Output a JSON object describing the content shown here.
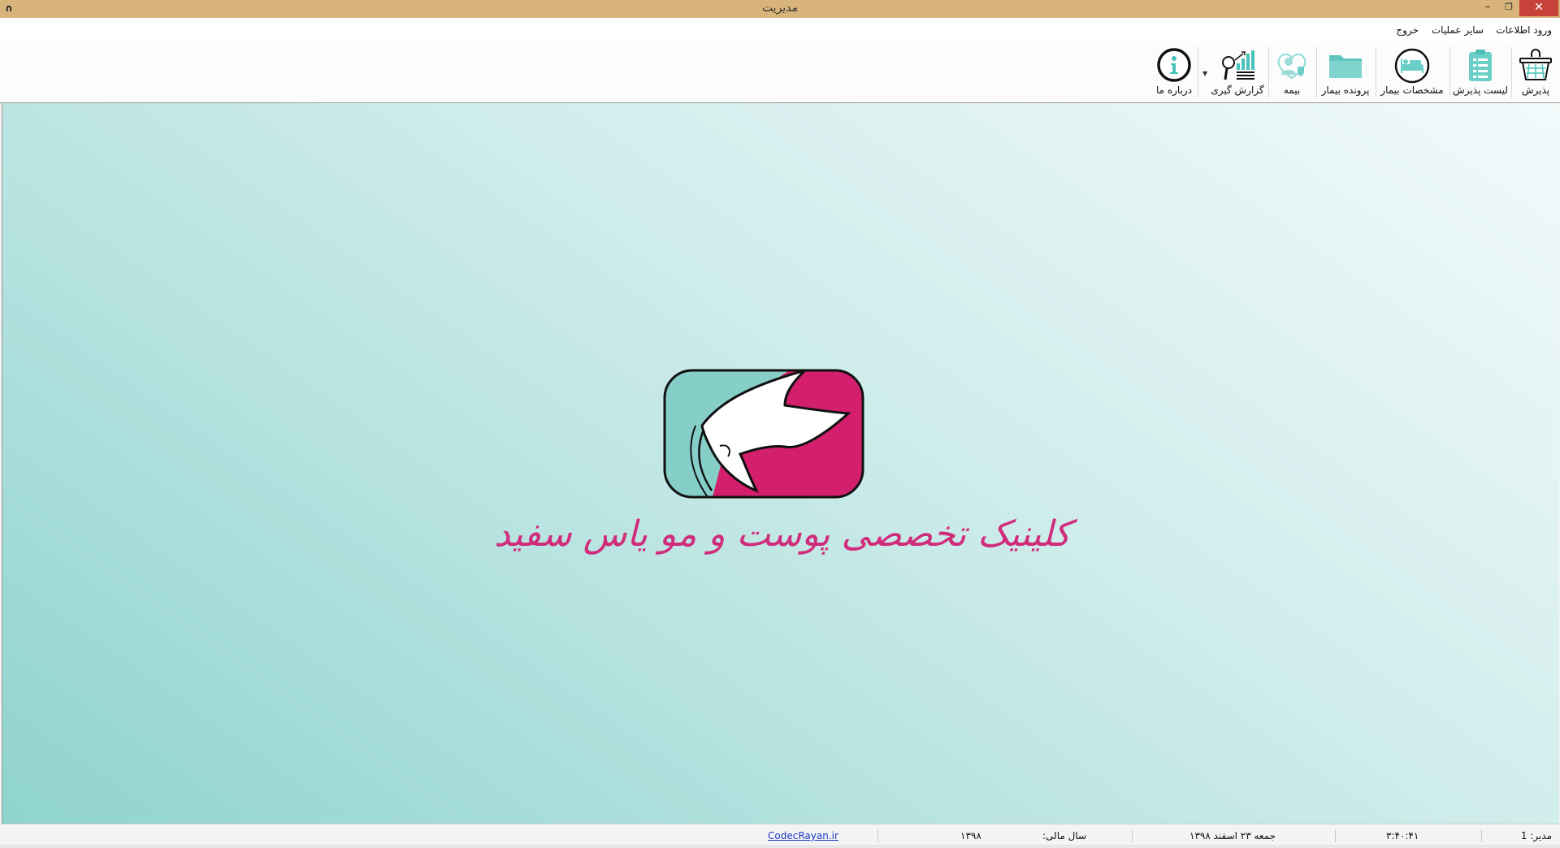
{
  "window": {
    "title": "مدیریت",
    "app_icon": "∩",
    "controls": {
      "minimize": "–",
      "maximize": "❐",
      "close": "✕"
    }
  },
  "menu": {
    "items": [
      {
        "label": "ورود اطلاعات"
      },
      {
        "label": "سایر عملیات"
      },
      {
        "label": "خروج"
      }
    ]
  },
  "toolbar": {
    "buttons": [
      {
        "label": "پذیرش",
        "icon": "basket-icon"
      },
      {
        "label": "لیست پذیرش",
        "icon": "clipboard-list-icon"
      },
      {
        "label": "مشخصات بیمار",
        "icon": "patient-bed-icon"
      },
      {
        "label": "پرونده بیمار",
        "icon": "folder-icon"
      },
      {
        "label": "بیمه",
        "icon": "insurance-person-icon"
      },
      {
        "label": "گزارش گیری",
        "icon": "report-chart-icon"
      },
      {
        "label": "درباره ما",
        "icon": "info-icon"
      }
    ]
  },
  "main": {
    "clinic_name": "کلینیک تخصصی پوست و مو یاس سفید",
    "logo_icon": "clinic-logo",
    "colors": {
      "teal": "#86cfc9",
      "magenta": "#d41e6e",
      "text": "#d12b7c"
    }
  },
  "status": {
    "manager_label": "مدیر: 1",
    "time": "۳:۴۰:۴۱",
    "date": "جمعه ۲۳ اسفند ۱۳۹۸",
    "fiscal_year_label": "سال مالی:",
    "fiscal_year": "۱۳۹۸",
    "website": "CodecRayan.ir"
  }
}
